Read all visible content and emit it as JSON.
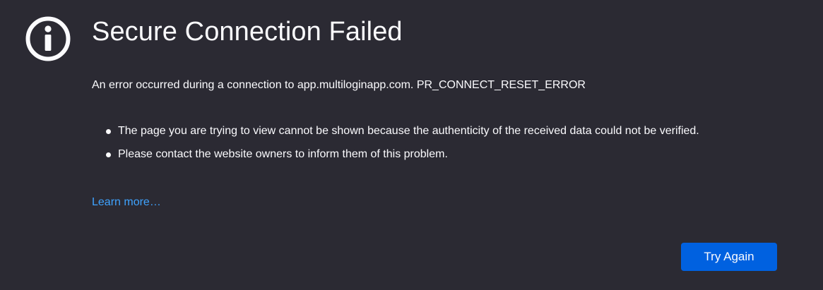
{
  "error_page": {
    "icon": "info-icon",
    "title": "Secure Connection Failed",
    "short_description": "An error occurred during a connection to app.multiloginapp.com. PR_CONNECT_RESET_ERROR",
    "details": [
      "The page you are trying to view cannot be shown because the authenticity of the received data could not be verified.",
      "Please contact the website owners to inform them of this problem."
    ],
    "learn_more_label": "Learn more…",
    "try_again_label": "Try Again"
  },
  "colors": {
    "background": "#2b2a33",
    "text": "#fbfbfe",
    "link": "#3fa3ff",
    "primary_button": "#0061e0"
  }
}
